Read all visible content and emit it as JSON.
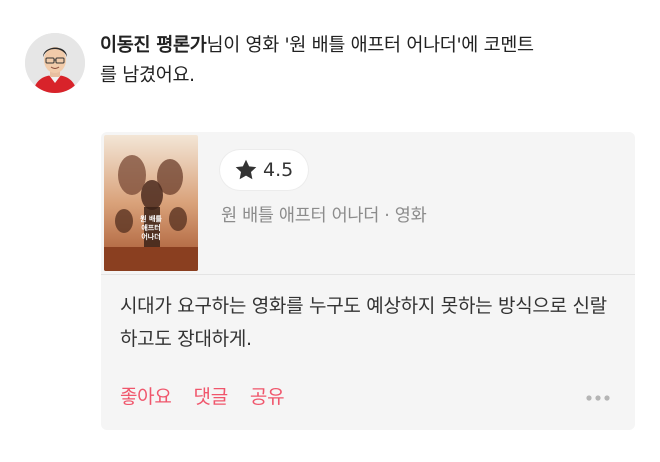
{
  "activity": {
    "author_name": "이동진 평론가",
    "text_after_name": "님이 영화 '원 배틀 애프터 어나더'에 코멘트",
    "text_line2": "를 남겼어요."
  },
  "card": {
    "rating": "4.5",
    "movie_meta": "원 배틀 애프터 어나더 · 영화",
    "poster_title_lines": [
      "원 배틀",
      "애프터",
      "어나더"
    ],
    "comment": "시대가 요구하는 영화를 누구도 예상하지 못하는 방식으로 신랄하고도 장대하게.",
    "actions": {
      "like": "좋아요",
      "reply": "댓글",
      "share": "공유"
    }
  },
  "icons": {
    "star": "star-icon",
    "more": "more-icon"
  },
  "colors": {
    "accent": "#f0566c",
    "card_bg": "#f5f5f5",
    "meta_text": "#8c8c8c"
  }
}
